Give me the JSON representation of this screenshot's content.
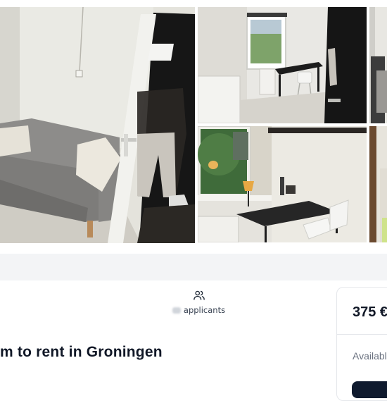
{
  "gallery": {
    "photos": [
      {
        "icon": "room-photo-couch-door"
      },
      {
        "icon": "room-photo-desk-window"
      },
      {
        "icon": "room-photo-partial"
      },
      {
        "icon": "room-photo-desk-lamp"
      },
      {
        "icon": "room-photo-partial"
      }
    ]
  },
  "listing": {
    "applicants_label": "applicants",
    "title": "m to rent in Groningen"
  },
  "price_card": {
    "price": "375 €",
    "availability": "Availabl"
  },
  "colors": {
    "band": "#f3f4f6",
    "cta": "#0f1a2e",
    "border": "#e5e7eb"
  }
}
